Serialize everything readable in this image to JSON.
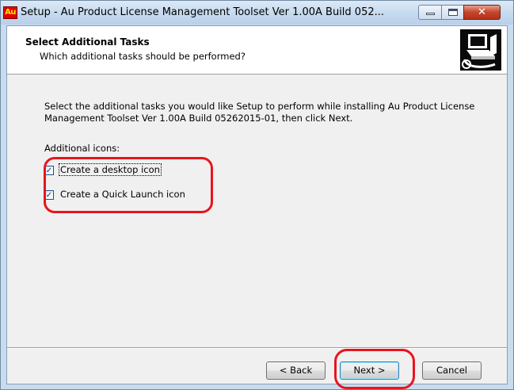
{
  "window": {
    "title": "Setup - Au Product License Management Toolset Ver 1.00A Build 052...",
    "app_icon_text": "Au",
    "minimize_icon": "minimize-icon",
    "maximize_icon": "maximize-icon",
    "close_icon": "close-icon",
    "close_glyph": "✕"
  },
  "header": {
    "title": "Select Additional Tasks",
    "subtitle": "Which additional tasks should be performed?",
    "image_icon": "computer-install-icon"
  },
  "body": {
    "description": "Select the additional tasks you would like Setup to perform while installing Au Product License Management Toolset Ver 1.00A Build 05262015-01, then click Next.",
    "group_label": "Additional icons:",
    "tasks": [
      {
        "label": "Create a desktop icon",
        "checked": true,
        "focused": true
      },
      {
        "label": "Create a Quick Launch icon",
        "checked": true,
        "focused": false
      }
    ],
    "check_glyph": "✓"
  },
  "buttons": {
    "back": "< Back",
    "next": "Next >",
    "cancel": "Cancel"
  },
  "colors": {
    "annotation": "#e8141e",
    "title_bar": "#c5d9ee",
    "close_button": "#c4452c"
  }
}
